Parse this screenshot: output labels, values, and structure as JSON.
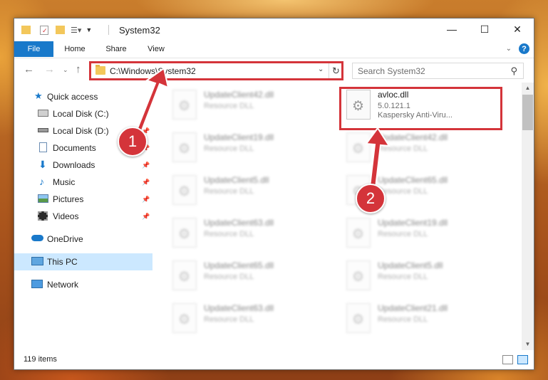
{
  "window": {
    "title": "System32",
    "controls": {
      "minimize": "—",
      "maximize": "☐",
      "close": "✕"
    }
  },
  "ribbon": {
    "tabs": [
      "File",
      "Home",
      "Share",
      "View"
    ],
    "help": "?"
  },
  "address": {
    "path": "C:\\Windows\\System32",
    "refresh": "↻"
  },
  "search": {
    "placeholder": "Search System32"
  },
  "sidebar": {
    "items": [
      {
        "label": "Quick access",
        "icon": "star-icon",
        "pinned": false
      },
      {
        "label": "Local Disk (C:)",
        "icon": "drive-icon",
        "pinned": true
      },
      {
        "label": "Local Disk (D:)",
        "icon": "drive-icon",
        "pinned": true
      },
      {
        "label": "Documents",
        "icon": "documents-icon",
        "pinned": true
      },
      {
        "label": "Downloads",
        "icon": "downloads-icon",
        "pinned": true
      },
      {
        "label": "Music",
        "icon": "music-icon",
        "pinned": true
      },
      {
        "label": "Pictures",
        "icon": "pictures-icon",
        "pinned": true
      },
      {
        "label": "Videos",
        "icon": "videos-icon",
        "pinned": true
      },
      {
        "label": "OneDrive",
        "icon": "cloud-icon",
        "pinned": false
      },
      {
        "label": "This PC",
        "icon": "computer-icon",
        "pinned": false,
        "selected": true
      },
      {
        "label": "Network",
        "icon": "network-icon",
        "pinned": false
      }
    ]
  },
  "files": [
    {
      "name": "UpdateClient42.dll",
      "type": "Resource DLL"
    },
    {
      "name": "avloc.dll",
      "version": "5.0.121.1",
      "company": "Kaspersky Anti-Viru..."
    },
    {
      "name": "UpdateClient19.dll",
      "type": "Resource DLL"
    },
    {
      "name": "UpdateClient42.dll",
      "type": "Resource DLL"
    },
    {
      "name": "UpdateClient5.dll",
      "type": "Resource DLL"
    },
    {
      "name": "UpdateClient65.dll",
      "type": "Resource DLL"
    },
    {
      "name": "UpdateClient63.dll",
      "type": "Resource DLL"
    },
    {
      "name": "UpdateClient19.dll",
      "type": "Resource DLL"
    },
    {
      "name": "UpdateClient65.dll",
      "type": "Resource DLL"
    },
    {
      "name": "UpdateClient5.dll",
      "type": "Resource DLL"
    },
    {
      "name": "UpdateClient63.dll",
      "type": "Resource DLL"
    },
    {
      "name": "UpdateClient21.dll",
      "type": "Resource DLL"
    }
  ],
  "status": {
    "item_count": "119 items"
  },
  "annotations": {
    "badge1": "1",
    "badge2": "2",
    "color": "#d4343a"
  }
}
